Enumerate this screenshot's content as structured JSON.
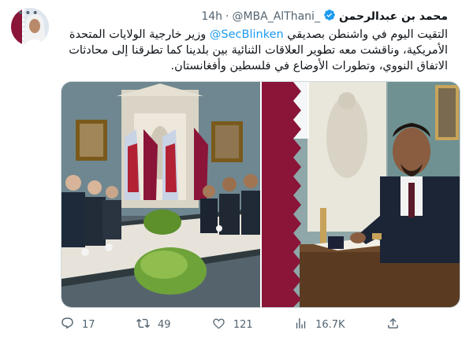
{
  "author": {
    "name": "محمد بن عبدالرحمن",
    "handle": "@MBA_AlThani_",
    "separator": "·",
    "time": "14h"
  },
  "tweet": {
    "text_before": "التقيت اليوم في واشنطن بصديقي ",
    "mention": "@SecBlinken",
    "text_after": " وزير خارجية الولايات المتحدة الأمريكية، وناقشت معه تطوير العلاقات الثنائية بين بلدينا كما تطرقنا إلى محادثات الاتفاق النووي، وتطورات الأوضاع في فلسطين وأفغانستان."
  },
  "media": [
    {
      "icon": "photo-meeting-table"
    },
    {
      "icon": "photo-signing-guestbook"
    }
  ],
  "actions": {
    "replies": "17",
    "retweets": "49",
    "likes": "121",
    "views": "16.7K"
  },
  "colors": {
    "accent": "#1d9bf0",
    "text_secondary": "#536471",
    "qatar_maroon": "#8a1538"
  }
}
